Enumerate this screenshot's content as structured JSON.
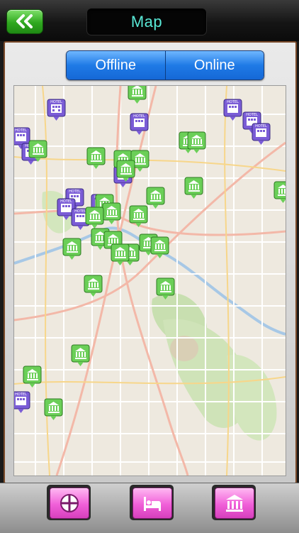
{
  "header": {
    "back_icon": "double-chevron-left-icon",
    "title": "Map"
  },
  "map_mode": {
    "options": [
      "Offline",
      "Online"
    ],
    "selected": "Offline"
  },
  "map": {
    "markers": {
      "museum_icon": "museum-icon",
      "hotel_icon": "hotel-icon",
      "hotel_label": "HOTEL"
    }
  },
  "toolbar": {
    "tabs": [
      {
        "icon": "crosshair-icon"
      },
      {
        "icon": "bed-icon"
      },
      {
        "icon": "museum-icon"
      }
    ]
  },
  "colors": {
    "accent_green": "#3db02c",
    "segment_blue": "#1f7ae6",
    "tab_pink": "#f05fd8",
    "title_text": "#59e8d6",
    "hotel_purple": "#7a5cd6"
  }
}
